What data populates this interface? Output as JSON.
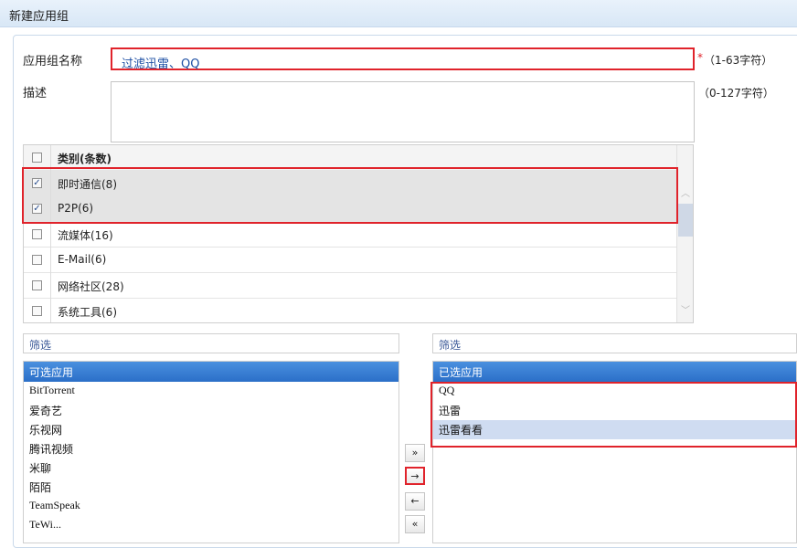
{
  "window": {
    "title": "新建应用组"
  },
  "form": {
    "name_label": "应用组名称",
    "name_value": "过滤迅雷、QQ",
    "name_required": "*",
    "name_hint": "（1-63字符）",
    "desc_label": "描述",
    "desc_value": "",
    "desc_hint": "（0-127字符）"
  },
  "categories": {
    "header": "类别(条数)",
    "rows": [
      {
        "label": "即时通信(8)",
        "checked": true
      },
      {
        "label": "P2P(6)",
        "checked": true
      },
      {
        "label": "流媒体(16)",
        "checked": false
      },
      {
        "label": "E-Mail(6)",
        "checked": false
      },
      {
        "label": "网络社区(28)",
        "checked": false
      },
      {
        "label": "系统工具(6)",
        "checked": false
      }
    ]
  },
  "available": {
    "filter_label": "筛选",
    "header": "可选应用",
    "items": [
      "BitTorrent",
      "爱奇艺",
      "乐视网",
      "腾讯视频",
      "米聊",
      "陌陌",
      "TeamSpeak",
      "TeWi..."
    ]
  },
  "selected": {
    "filter_label": "筛选",
    "header": "已选应用",
    "items": [
      "QQ",
      "迅雷",
      "迅雷看看"
    ]
  },
  "move_buttons": {
    "add_all": "»",
    "add": "→",
    "remove": "←",
    "remove_all": "«"
  },
  "colors": {
    "highlight_red": "#e0232b",
    "list_header_blue": "#2b6fc8"
  }
}
